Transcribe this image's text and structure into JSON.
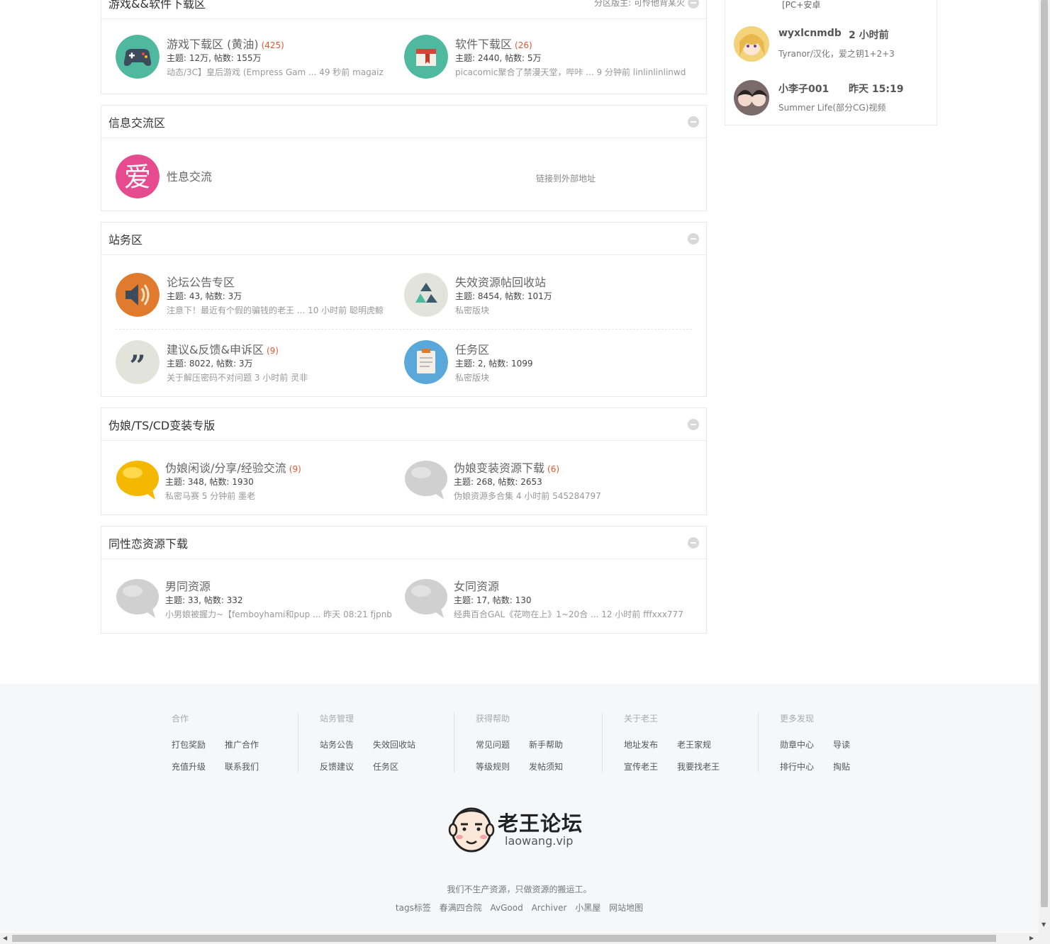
{
  "categories": [
    {
      "id": "games",
      "title": "游戏&&软件下载区",
      "moderator": "分区版主: 可怜他背某火",
      "forums": [
        {
          "name": "游戏下载区 (黄油)",
          "count": "(425)",
          "stats": "主题: 12万, 帖数: 155万",
          "last": "动态/3C】皇后游戏 (Empress Gam ... 49 秒前 magaiz",
          "icon": "gamepad-icon"
        },
        {
          "name": "软件下载区",
          "count": "(26)",
          "stats": "主题: 2440, 帖数: 5万",
          "last": "picacomic聚合了禁漫天堂，哔咔 ... 9 分钟前 linlinlinlinwd",
          "icon": "software-box-icon"
        }
      ]
    },
    {
      "id": "info",
      "title": "信息交流区",
      "forums": [
        {
          "name": "性息交流",
          "icon": "love-icon",
          "external": "链接到外部地址"
        }
      ]
    },
    {
      "id": "site",
      "title": "站务区",
      "forums": [
        {
          "name": "论坛公告专区",
          "stats": "主题: 43, 帖数: 3万",
          "last": "注意下！最近有个假的骗钱的老王 ... 10 小时前 聪明虎鲸",
          "icon": "speaker-icon"
        },
        {
          "name": "失效资源帖回收站",
          "stats": "主题: 8454, 帖数: 101万",
          "last": "私密版块",
          "icon": "recycle-icon"
        },
        {
          "name": "建议&反馈&申诉区",
          "count": "(9)",
          "stats": "主题: 8022, 帖数: 3万",
          "last": "关于解压密码不对问题 3 小时前 灵非",
          "icon": "quote-icon"
        },
        {
          "name": "任务区",
          "stats": "主题: 2, 帖数: 1099",
          "last": "私密版块",
          "icon": "clipboard-icon"
        }
      ]
    },
    {
      "id": "cd",
      "title": "伪娘/TS/CD变装专版",
      "forums": [
        {
          "name": "伪娘闲谈/分享/经验交流",
          "count": "(9)",
          "stats": "主题: 348, 帖数: 1930",
          "last": "私密马赛 5 分钟前 墨老",
          "icon": "chat-bubble-yellow-icon"
        },
        {
          "name": "伪娘变装资源下载",
          "count": "(6)",
          "stats": "主题: 268, 帖数: 2653",
          "last": "伪娘资源多合集 4 小时前 545284797",
          "icon": "chat-bubble-gray-icon"
        }
      ]
    },
    {
      "id": "gay",
      "title": "同性恋资源下载",
      "forums": [
        {
          "name": "男同资源",
          "stats": "主题: 33, 帖数: 332",
          "last": "小男娘被握力~【femboyhami和pup ... 昨天 08:21 fjpnb",
          "icon": "chat-bubble-gray-icon"
        },
        {
          "name": "女同资源",
          "stats": "主题: 17, 帖数: 130",
          "last": "经典百合GAL《花吻在上》1~20合 ... 12 小时前 fffxxx777",
          "icon": "chat-bubble-gray-icon"
        }
      ]
    }
  ],
  "sidebar": {
    "top_text": "[PC+安卓",
    "members": [
      {
        "name": "wyxlcnmdb",
        "time": "2 小时前",
        "desc": "Tyranor/汉化，爱之钥1+2+3"
      },
      {
        "name": "小李子001",
        "time": "昨天 15:19",
        "desc": "Summer Life(部分CG)视频"
      }
    ]
  },
  "footer": {
    "columns": [
      {
        "title": "合作",
        "links": [
          "打包奖励",
          "推广合作",
          "充值升级",
          "联系我们"
        ]
      },
      {
        "title": "站务管理",
        "links": [
          "站务公告",
          "失效回收站",
          "反馈建议",
          "任务区"
        ]
      },
      {
        "title": "获得帮助",
        "links": [
          "常见问题",
          "新手帮助",
          "等级规则",
          "发帖须知"
        ]
      },
      {
        "title": "关于老王",
        "links": [
          "地址发布",
          "老王家规",
          "宣传老王",
          "我要找老王"
        ]
      },
      {
        "title": "更多发现",
        "links": [
          "勋章中心",
          "导读",
          "排行中心",
          "掏贴"
        ]
      }
    ],
    "logo_text": "老王论坛",
    "logo_domain": "laowang.vip",
    "slogan": "我们不生产资源，只做资源的搬运工。",
    "bottom_links": [
      "tags标签",
      "春满四合院",
      "AvGood",
      "Archiver",
      "小黑屋",
      "网站地图"
    ]
  }
}
